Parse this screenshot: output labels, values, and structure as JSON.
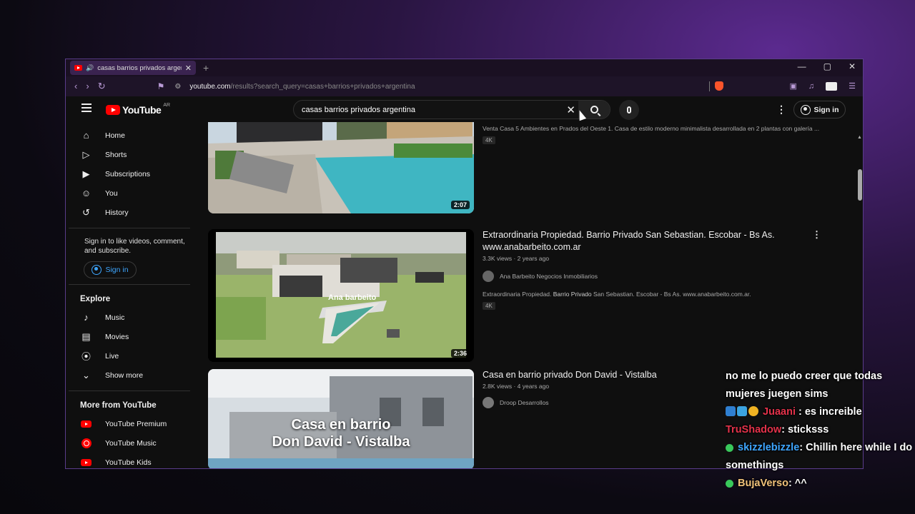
{
  "browser": {
    "tab_title": "casas barrios privados argentina",
    "new_tab": "+",
    "url_domain": "youtube.com",
    "url_path": "/results?search_query=casas+barrios+privados+argentina",
    "window_controls": [
      "—",
      "▢",
      "✕"
    ]
  },
  "youtube": {
    "logo_text": "YouTube",
    "country_code": "AR",
    "search_value": "casas barrios privados argentina",
    "signin_label": "Sign in"
  },
  "sidebar": {
    "main": [
      {
        "label": "Home",
        "icon": "home-icon"
      },
      {
        "label": "Shorts",
        "icon": "shorts-icon"
      },
      {
        "label": "Subscriptions",
        "icon": "subscriptions-icon"
      },
      {
        "label": "You",
        "icon": "you-icon"
      },
      {
        "label": "History",
        "icon": "history-icon"
      }
    ],
    "signin_note": "Sign in to like videos, comment, and subscribe.",
    "signin_label": "Sign in",
    "explore_title": "Explore",
    "explore": [
      {
        "label": "Music",
        "icon": "music-icon"
      },
      {
        "label": "Movies",
        "icon": "movies-icon"
      },
      {
        "label": "Live",
        "icon": "live-icon"
      },
      {
        "label": "Show more",
        "icon": "chevron-down-icon"
      }
    ],
    "more_title": "More from YouTube",
    "more": [
      {
        "label": "YouTube Premium"
      },
      {
        "label": "YouTube Music"
      },
      {
        "label": "YouTube Kids"
      }
    ]
  },
  "results": [
    {
      "title": "",
      "desc": "Venta Casa 5 Ambientes en Prados del Oeste 1. Casa de estilo moderno minimalista desarrollada en 2 plantas con galería ...",
      "badge": "4K",
      "duration": "2:07"
    },
    {
      "title": "Extraordinaria Propiedad. Barrio Privado San Sebastian. Escobar - Bs As. www.anabarbeito.com.ar",
      "views": "3.3K views · 2 years ago",
      "channel": "Ana Barbeito Negocios Inmobiliarios",
      "desc_pre": "Extraordinaria Propiedad. ",
      "desc_bold": "Barrio Privado",
      "desc_post": " San Sebastian. Escobar - Bs As. www.anabarbeito.com.ar.",
      "badge": "4K",
      "duration": "2:36",
      "watermark": "Ana barbeito"
    },
    {
      "title": "Casa en barrio privado Don David - Vistalba",
      "views": "2.8K views · 4 years ago",
      "channel": "Droop Desarrollos",
      "thumb_line1": "Casa en barrio",
      "thumb_line2": "Don David - Vistalba"
    }
  ],
  "chat": {
    "messages": [
      {
        "user": "",
        "text": "no me lo puedo creer que todas mujeres juegen sims"
      },
      {
        "user": "Juaani",
        "text": ": es increible"
      },
      {
        "user": "TruShadow",
        "text": ": sticksss"
      },
      {
        "user": "skizzlebizzle",
        "text": ": Chillin here while I do somethings"
      },
      {
        "user": "BujaVerso",
        "text": ": ^^"
      }
    ]
  }
}
